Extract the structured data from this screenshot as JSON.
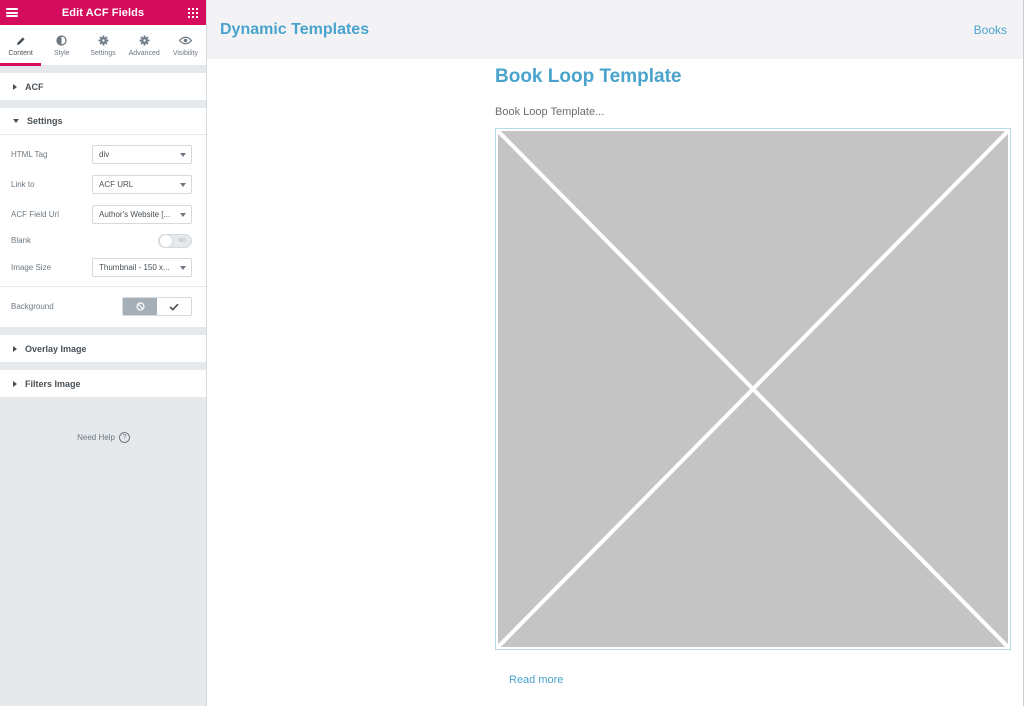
{
  "panel": {
    "title": "Edit ACF Fields",
    "accent": "#d30c5c",
    "tabs": [
      {
        "label": "Content",
        "icon": "pencil-icon"
      },
      {
        "label": "Style",
        "icon": "half-circle-icon"
      },
      {
        "label": "Settings",
        "icon": "gear-icon"
      },
      {
        "label": "Advanced",
        "icon": "gear-icon"
      },
      {
        "label": "Visibility",
        "icon": "eye-icon"
      }
    ],
    "sections": {
      "acf": "ACF",
      "settings": "Settings",
      "overlay": "Overlay Image",
      "filters": "Filters Image"
    },
    "fields": {
      "html_tag": {
        "label": "HTML Tag",
        "value": "div"
      },
      "link_to": {
        "label": "Link to",
        "value": "ACF URL"
      },
      "acf_field_url": {
        "label": "ACF Field Url",
        "value": "Author's Website [..."
      },
      "blank": {
        "label": "Blank",
        "state": "NO"
      },
      "image_size": {
        "label": "Image Size",
        "value": "Thumbnail - 150 x..."
      },
      "background": {
        "label": "Background"
      }
    },
    "need_help": "Need Help",
    "need_help_glyph": "?"
  },
  "preview": {
    "site_title": "Dynamic Templates",
    "nav_item": "Books",
    "post_title": "Book Loop Template",
    "excerpt": "Book Loop Template...",
    "read_more": "Read more",
    "link_color": "#4aa3cc"
  }
}
